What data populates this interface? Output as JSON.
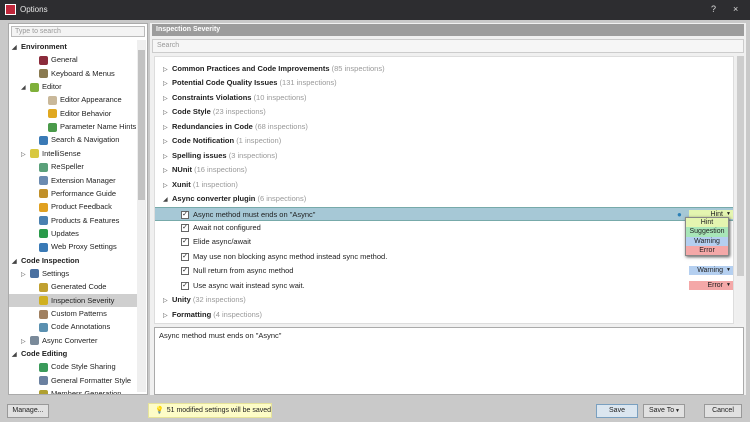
{
  "window": {
    "title": "Options",
    "help": "?",
    "close": "×"
  },
  "left": {
    "search_placeholder": "Type to search",
    "items": [
      {
        "label": "Environment",
        "level": 0,
        "bold": true,
        "arrow": "◢"
      },
      {
        "label": "General",
        "level": 2,
        "color": "#8b2b3b"
      },
      {
        "label": "Keyboard & Menus",
        "level": 2,
        "color": "#8a7a50"
      },
      {
        "label": "Editor",
        "level": 1,
        "arrow": "◢",
        "color": "#7fb03a"
      },
      {
        "label": "Editor Appearance",
        "level": 3,
        "color": "#c9b89a"
      },
      {
        "label": "Editor Behavior",
        "level": 3,
        "color": "#e0a820"
      },
      {
        "label": "Parameter Name Hints",
        "level": 3,
        "color": "#4a9a4a"
      },
      {
        "label": "Search & Navigation",
        "level": 2,
        "color": "#3a7ab6"
      },
      {
        "label": "IntelliSense",
        "level": 1,
        "arrow": "▷",
        "color": "#d8c840"
      },
      {
        "label": "ReSpeller",
        "level": 2,
        "color": "#5aa07a"
      },
      {
        "label": "Extension Manager",
        "level": 2,
        "color": "#6a8ab0"
      },
      {
        "label": "Performance Guide",
        "level": 2,
        "color": "#c0902a"
      },
      {
        "label": "Product Feedback",
        "level": 2,
        "color": "#e0a020"
      },
      {
        "label": "Products & Features",
        "level": 2,
        "color": "#4a80b0"
      },
      {
        "label": "Updates",
        "level": 2,
        "color": "#2a9a4a"
      },
      {
        "label": "Web Proxy Settings",
        "level": 2,
        "color": "#3a7ab6"
      },
      {
        "label": "Code Inspection",
        "level": 0,
        "bold": true,
        "arrow": "◢"
      },
      {
        "label": "Settings",
        "level": 1,
        "arrow": "▷",
        "color": "#4a70a0"
      },
      {
        "label": "Generated Code",
        "level": 2,
        "color": "#c0a030"
      },
      {
        "label": "Inspection Severity",
        "level": 2,
        "color": "#d0b020",
        "selected": true
      },
      {
        "label": "Custom Patterns",
        "level": 2,
        "color": "#a08060"
      },
      {
        "label": "Code Annotations",
        "level": 2,
        "color": "#5a90b0"
      },
      {
        "label": "Async Converter",
        "level": 1,
        "arrow": "▷",
        "color": "#7a8a9a"
      },
      {
        "label": "Code Editing",
        "level": 0,
        "bold": true,
        "arrow": "◢"
      },
      {
        "label": "Code Style Sharing",
        "level": 2,
        "color": "#3a9a5a"
      },
      {
        "label": "General Formatter Style",
        "level": 2,
        "color": "#6a80a0"
      },
      {
        "label": "Members Generation",
        "level": 2,
        "color": "#b0a030"
      }
    ]
  },
  "right": {
    "header": "Inspection Severity",
    "search_placeholder": "Search",
    "rows": [
      {
        "label": "Common Practices and Code Improvements",
        "count": "(85 inspections)",
        "arrow": "▷"
      },
      {
        "label": "Potential Code Quality Issues",
        "count": "(131 inspections)",
        "arrow": "▷"
      },
      {
        "label": "Constraints Violations",
        "count": "(10 inspections)",
        "arrow": "▷"
      },
      {
        "label": "Code Style",
        "count": "(23 inspections)",
        "arrow": "▷"
      },
      {
        "label": "Redundancies in Code",
        "count": "(68 inspections)",
        "arrow": "▷"
      },
      {
        "label": "Code Notification",
        "count": "(1 inspection)",
        "arrow": "▷"
      },
      {
        "label": "Spelling issues",
        "count": "(3 inspections)",
        "arrow": "▷"
      },
      {
        "label": "NUnit",
        "count": "(16 inspections)",
        "arrow": "▷"
      },
      {
        "label": "Xunit",
        "count": "(1 inspection)",
        "arrow": "▷"
      },
      {
        "label": "Async converter plugin",
        "count": "(6 inspections)",
        "arrow": "◢"
      },
      {
        "label": "Async method must ends on \"Async\"",
        "check": true,
        "severity": "Hint",
        "highlighted": true
      },
      {
        "label": "Await not configured",
        "check": true
      },
      {
        "label": "Elide async/await",
        "check": true
      },
      {
        "label": "May use non blocking async method instead sync method.",
        "check": true
      },
      {
        "label": "Null return from async method",
        "check": true,
        "severity": "Warning"
      },
      {
        "label": "Use async wait instead sync wait.",
        "check": true,
        "severity": "Error"
      },
      {
        "label": "Unity",
        "count": "(32 inspections)",
        "arrow": "▷"
      },
      {
        "label": "Formatting",
        "count": "(4 inspections)",
        "arrow": "▷"
      }
    ],
    "severity_options": [
      "Hint",
      "Suggestion",
      "Warning",
      "Error"
    ],
    "severity_colors": {
      "Hint": "#e4f5b0",
      "Suggestion": "#a8e6b8",
      "Warning": "#b4cff0",
      "Error": "#f4a8a8"
    },
    "description": "Async method must ends on \"Async\""
  },
  "footer": {
    "manage": "Manage...",
    "note": "51 modified settings will be saved",
    "save": "Save",
    "save_to": "Save To",
    "cancel": "Cancel"
  }
}
